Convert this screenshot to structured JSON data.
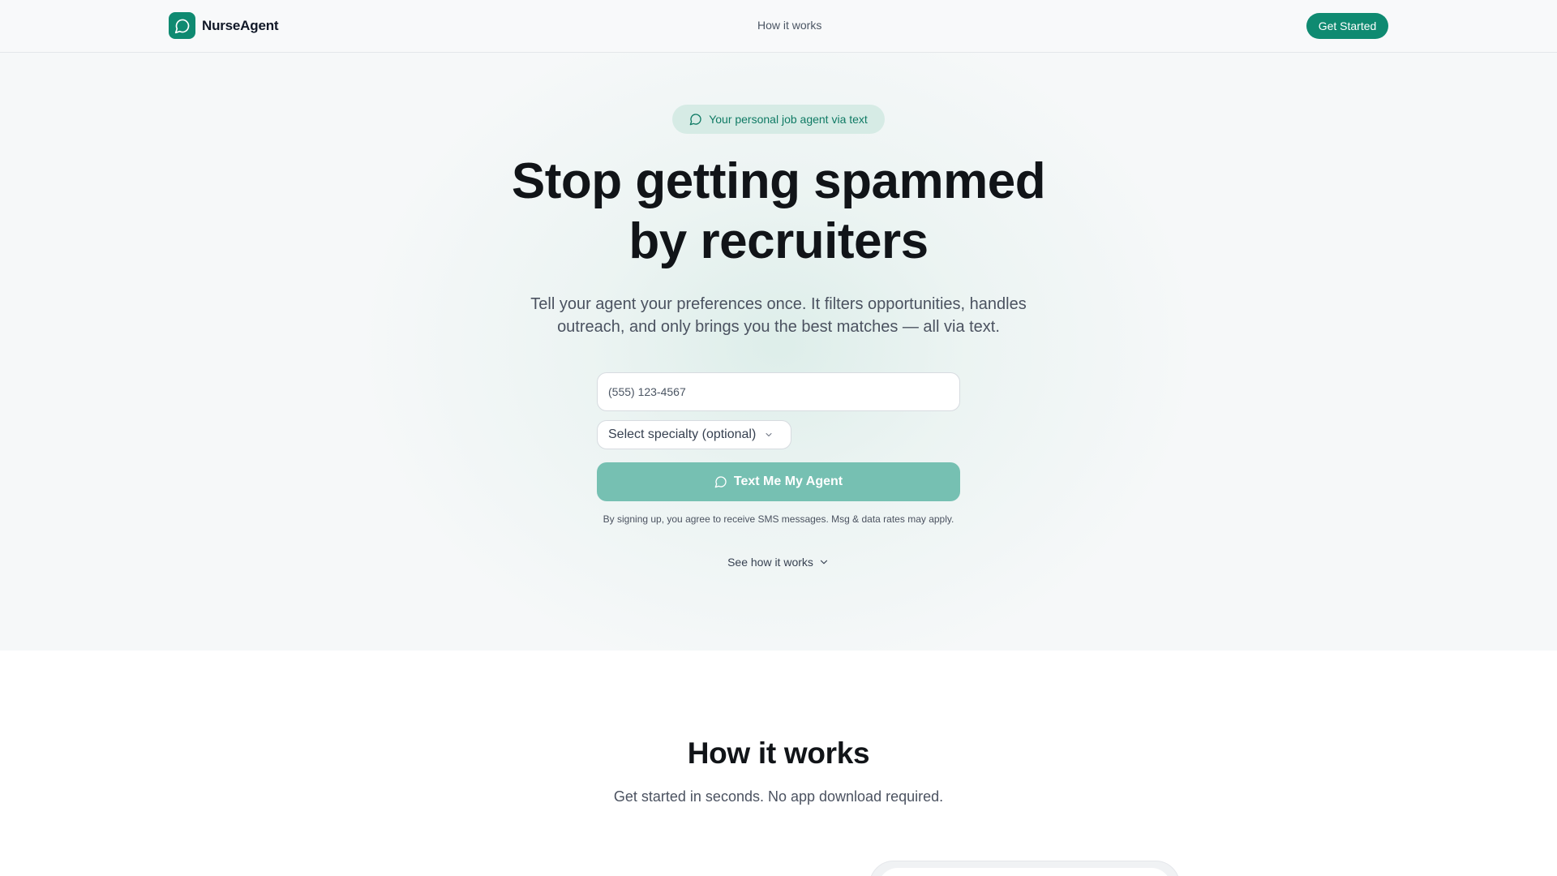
{
  "header": {
    "brand": "NurseAgent",
    "nav_link": "How it works",
    "cta_label": "Get Started"
  },
  "hero": {
    "badge_text": "Your personal job agent via text",
    "headline_line1": "Stop getting spammed",
    "headline_line2": "by recruiters",
    "subhead_line1": "Tell your agent your preferences once. It filters opportunities, handles",
    "subhead_line2": "outreach, and only brings you the best matches — all via text.",
    "phone_placeholder": "(555) 123-4567",
    "specialty_label": "Select specialty (optional)",
    "submit_label": "Text Me My Agent",
    "disclaimer": "By signing up, you agree to receive SMS messages. Msg & data rates may apply.",
    "see_how_label": "See how it works"
  },
  "how_it_works": {
    "title": "How it works",
    "subtitle": "Get started in seconds. No app download required."
  },
  "colors": {
    "brand": "#0f8a71",
    "button_disabled": "#76c0b2",
    "badge_bg": "#d6ebe5",
    "badge_text": "#0f7a64"
  },
  "icons": {
    "logo": "message-circle-icon",
    "badge": "message-circle-icon",
    "specialty": "chevron-down-icon",
    "submit": "message-circle-icon",
    "see_how": "chevron-down-icon"
  }
}
